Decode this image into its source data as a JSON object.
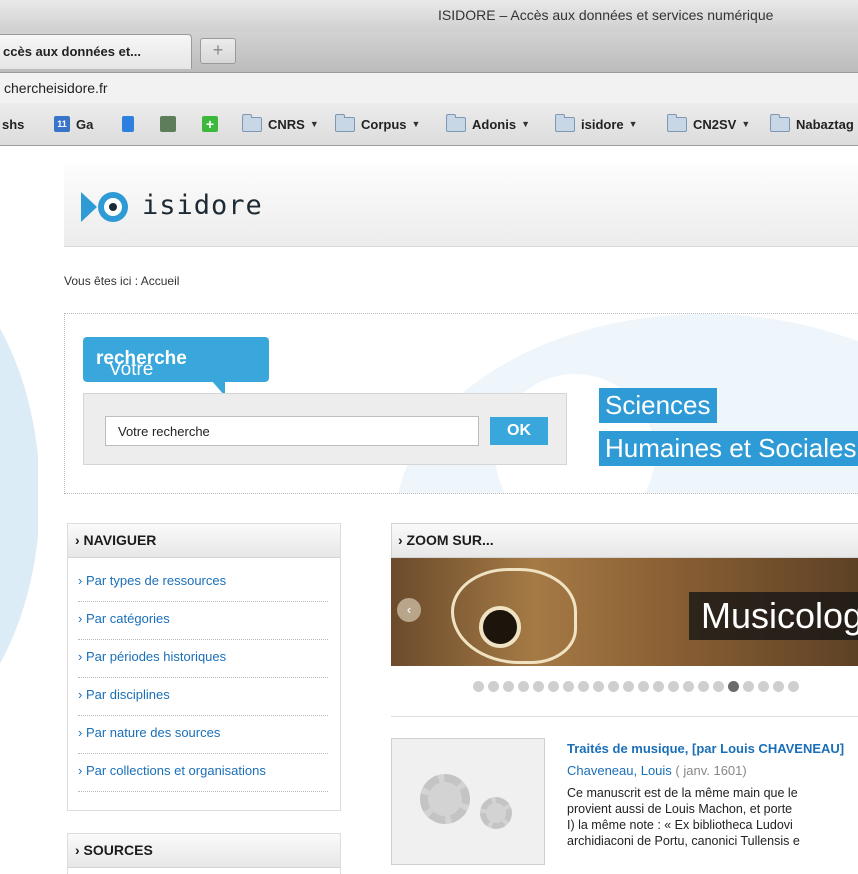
{
  "browser": {
    "window_title": "ISIDORE – Accès aux données et services numérique",
    "tab_title": "ccès aux données et...",
    "new_tab": "+",
    "url": "chercheisidore.fr",
    "bookmarks": [
      {
        "label": "shs",
        "type": "text"
      },
      {
        "label": "Ga",
        "type": "calendar"
      },
      {
        "label": "",
        "type": "doc"
      },
      {
        "label": "",
        "type": "evernote"
      },
      {
        "label": "",
        "type": "plus"
      },
      {
        "label": "CNRS",
        "type": "folder"
      },
      {
        "label": "Corpus",
        "type": "folder"
      },
      {
        "label": "Adonis",
        "type": "folder"
      },
      {
        "label": "isidore",
        "type": "folder"
      },
      {
        "label": "CN2SV",
        "type": "folder"
      },
      {
        "label": "Nabaztag",
        "type": "folder"
      }
    ],
    "calendar_day": "11"
  },
  "site": {
    "logo_text": "isidore",
    "breadcrumb": "Vous êtes ici : Accueil"
  },
  "search": {
    "bubble_prefix": "Votre ",
    "bubble_bold": "recherche",
    "input_value": "Votre recherche",
    "ok_label": "OK",
    "tagline_1": "Sciences",
    "tagline_2": "Humaines et Sociales"
  },
  "nav": {
    "heading": "› NAVIGUER",
    "items": [
      "› Par types de ressources",
      "› Par catégories",
      "› Par périodes historiques",
      "› Par disciplines",
      "› Par nature des sources",
      "› Par collections et organisations"
    ]
  },
  "sources": {
    "heading": "› SOURCES"
  },
  "zoom": {
    "heading": "› ZOOM SUR...",
    "slide_label": "Musicologie",
    "prev": "‹",
    "dots_total": 22,
    "dots_active_index": 17
  },
  "article": {
    "title": "Traités de musique, [par Louis CHAVENEAU]",
    "author": "Chaveneau, Louis",
    "date": " ( janv. 1601)",
    "desc_lines": [
      "Ce manuscrit est de la même main que le",
      "provient aussi de Louis Machon, et porte",
      "I) la même note : « Ex bibliotheca Ludovi",
      "archidiaconi de Portu, canonici Tullensis e"
    ]
  },
  "colors": {
    "accent": "#3aa7dc",
    "link": "#1a6fb8"
  }
}
